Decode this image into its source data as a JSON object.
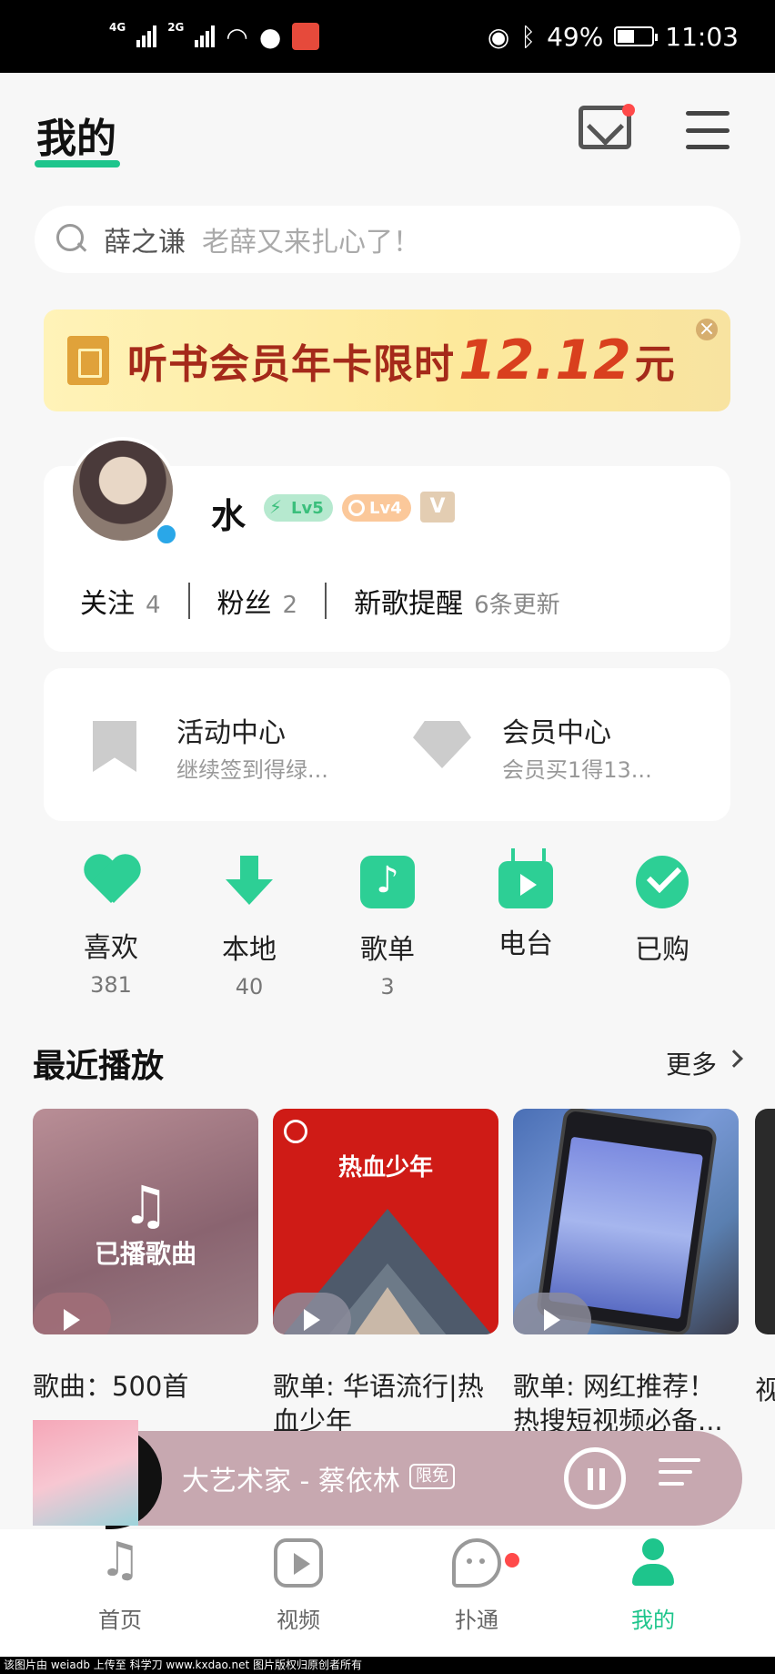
{
  "status_bar": {
    "net1": "4G",
    "net2": "2G",
    "battery": "49%",
    "battery_level": 0.49,
    "time": "11:03"
  },
  "header": {
    "title": "我的",
    "has_mail_notification": true
  },
  "search": {
    "main_text": "薛之谦",
    "sub_text": "老薛又来扎心了！"
  },
  "banner": {
    "text": "听书会员年卡限时",
    "price": "12.12",
    "unit": "元",
    "close": "×"
  },
  "profile": {
    "username": "水",
    "badge_green": "Lv5",
    "badge_orange": "Lv4",
    "badge_v": "V",
    "stats": [
      {
        "label": "关注",
        "value": "4"
      },
      {
        "label": "粉丝",
        "value": "2"
      },
      {
        "label": "新歌提醒",
        "value": "6条更新"
      }
    ]
  },
  "activity": {
    "items": [
      {
        "title": "活动中心",
        "subtitle": "继续签到得绿..."
      },
      {
        "title": "会员中心",
        "subtitle": "会员买1得13..."
      }
    ]
  },
  "quick": [
    {
      "label": "喜欢",
      "count": "381",
      "icon": "heart-icon"
    },
    {
      "label": "本地",
      "count": "40",
      "icon": "download-icon"
    },
    {
      "label": "歌单",
      "count": "3",
      "icon": "playlist-icon"
    },
    {
      "label": "电台",
      "count": "",
      "icon": "radio-icon"
    },
    {
      "label": "已购",
      "count": "",
      "icon": "check-icon"
    }
  ],
  "recent": {
    "title": "最近播放",
    "more": "更多",
    "cards": [
      {
        "title": "歌曲：500首",
        "cover_text": "已播歌曲"
      },
      {
        "title": "歌单: 华语流行|热血少年",
        "cover_text": "热血少年"
      },
      {
        "title": "歌单: 网红推荐！热搜短视频必备...",
        "cover_text": ""
      }
    ],
    "partial_card_text": "视"
  },
  "player": {
    "song": "大艺术家 - 蔡依林",
    "tag": "限免"
  },
  "tabs": [
    {
      "label": "首页",
      "active": false
    },
    {
      "label": "视频",
      "active": false
    },
    {
      "label": "扑通",
      "active": false
    },
    {
      "label": "我的",
      "active": true
    }
  ],
  "footer": {
    "text": "该图片由 weiadb 上传至 科学刀 www.kxdao.net 图片版权归原创者所有"
  },
  "colors": {
    "accent": "#1ec58c",
    "icon_green": "#2dcf95",
    "player_bg": "#c7a8b0",
    "banner_red": "#d9401e"
  }
}
